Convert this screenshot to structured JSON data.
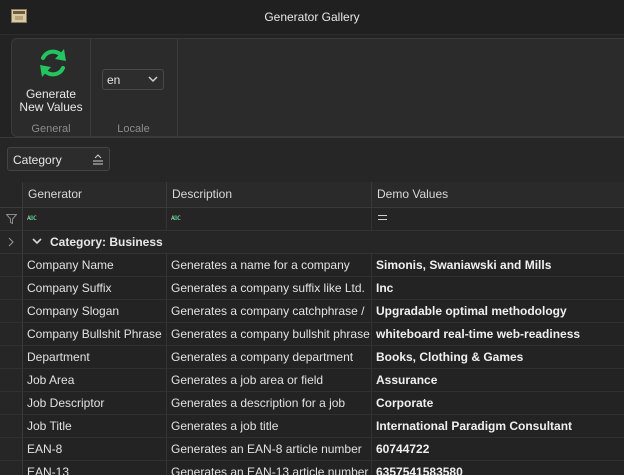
{
  "window": {
    "title": "Generator Gallery",
    "icon": "app-window-icon"
  },
  "ribbon": {
    "general": {
      "button_line1": "Generate",
      "button_line2": "New Values",
      "button_icon": "refresh-icon",
      "caption": "General"
    },
    "locale": {
      "value": "en",
      "caption": "Locale"
    }
  },
  "group_panel": {
    "chip_label": "Category",
    "sort_icon": "sort-ascending-icon"
  },
  "grid": {
    "columns": [
      "Generator",
      "Description",
      "Demo Values"
    ],
    "filter_icon": "filter-icon",
    "group_label": "Category: Business",
    "rows": [
      {
        "generator": "Company Name",
        "description": "Generates a name for a company",
        "demo": "Simonis, Swaniawski and Mills"
      },
      {
        "generator": "Company Suffix",
        "description": "Generates a company suffix like Ltd.",
        "demo": "Inc"
      },
      {
        "generator": "Company Slogan",
        "description": "Generates a company catchphrase /",
        "demo": "Upgradable optimal methodology"
      },
      {
        "generator": "Company Bullshit Phrase",
        "description": "Generates a company bullshit phrase",
        "demo": "whiteboard real-time web-readiness"
      },
      {
        "generator": "Department",
        "description": "Generates a company department",
        "demo": "Books, Clothing & Games"
      },
      {
        "generator": "Job Area",
        "description": "Generates a job area or field",
        "demo": "Assurance"
      },
      {
        "generator": "Job Descriptor",
        "description": "Generates a description for a job",
        "demo": "Corporate"
      },
      {
        "generator": "Job Title",
        "description": "Generates a job title",
        "demo": "International Paradigm Consultant"
      },
      {
        "generator": "EAN-8",
        "description": "Generates an EAN-8 article number",
        "demo": "60744722"
      },
      {
        "generator": "EAN-13",
        "description": "Generates an EAN-13 article number",
        "demo": "6357541583580"
      }
    ]
  },
  "colors": {
    "accent_green": "#22c55e",
    "background": "#232323"
  }
}
